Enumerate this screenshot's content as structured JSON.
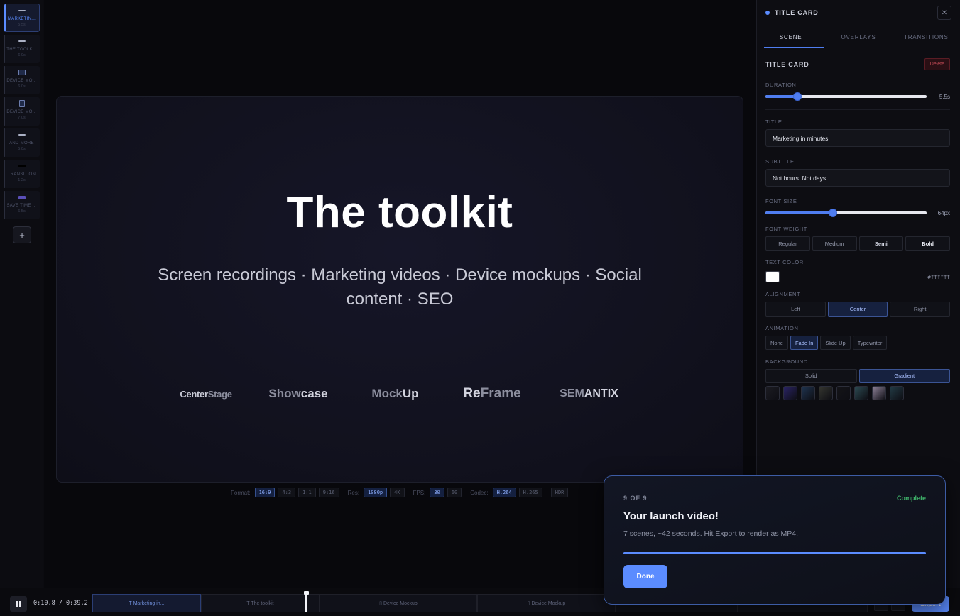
{
  "scenes": [
    {
      "name": "MARKETIN...",
      "duration": "5.5s",
      "glyph": "bar",
      "active": true
    },
    {
      "name": "THE TOOLK...",
      "duration": "6.0s",
      "glyph": "bar",
      "active": false
    },
    {
      "name": "DEVICE MO...",
      "duration": "6.0s",
      "glyph": "box",
      "active": false
    },
    {
      "name": "DEVICE MO...",
      "duration": "7.0s",
      "glyph": "phone",
      "active": false
    },
    {
      "name": "AND MORE",
      "duration": "5.0s",
      "glyph": "bar",
      "active": false
    },
    {
      "name": "TRANSITION",
      "duration": "1.2s",
      "glyph": "black",
      "active": false
    },
    {
      "name": "SAVE TIME ...",
      "duration": "6.5s",
      "glyph": "purple",
      "active": false
    }
  ],
  "add_scene_label": "+",
  "preview": {
    "title": "The toolkit",
    "subtitle": "Screen recordings · Marketing videos · Device mockups · Social content · SEO",
    "logos": {
      "centerstage": {
        "part1": "Center",
        "part2": "Stage"
      },
      "showcase": {
        "part1": "Show",
        "part2": "case"
      },
      "mockup": {
        "part1": "Mock",
        "part2": "Up"
      },
      "reframe": {
        "part1": "Re",
        "part2": "Frame"
      },
      "semantix": {
        "part1": "SEM",
        "part2": "ANTIX"
      }
    }
  },
  "format_bar": {
    "format_label": "Format:",
    "formats": [
      {
        "label": "16:9",
        "on": true
      },
      {
        "label": "4:3",
        "on": false
      },
      {
        "label": "1:1",
        "on": false
      },
      {
        "label": "9:16",
        "on": false
      }
    ],
    "res_label": "Res:",
    "resolutions": [
      {
        "label": "1080p",
        "on": true
      },
      {
        "label": "4K",
        "on": false
      }
    ],
    "fps_label": "FPS:",
    "fps": [
      {
        "label": "30",
        "on": true
      },
      {
        "label": "60",
        "on": false
      }
    ],
    "codec_label": "Codec:",
    "codecs": [
      {
        "label": "H.264",
        "on": true
      },
      {
        "label": "H.265",
        "on": false
      }
    ],
    "hdr_label": "HDR"
  },
  "panel": {
    "header_title": "TITLE CARD",
    "close_glyph": "✕",
    "tabs": [
      "SCENE",
      "OVERLAYS",
      "TRANSITIONS"
    ],
    "section_title": "TITLE CARD",
    "delete_label": "Delete",
    "duration": {
      "label": "DURATION",
      "value_text": "5.5s",
      "fraction": 0.2
    },
    "title_field": {
      "label": "TITLE",
      "value": "Marketing in minutes"
    },
    "subtitle_field": {
      "label": "SUBTITLE",
      "value": "Not hours. Not days."
    },
    "font_size": {
      "label": "FONT SIZE",
      "value_text": "64px",
      "fraction": 0.42
    },
    "font_weight": {
      "label": "FONT WEIGHT",
      "options": [
        "Regular",
        "Medium",
        "Semi",
        "Bold"
      ]
    },
    "text_color": {
      "label": "TEXT COLOR",
      "hex": "#ffffff"
    },
    "alignment": {
      "label": "ALIGNMENT",
      "options": [
        "Left",
        "Center",
        "Right"
      ],
      "selected": "Center"
    },
    "animation": {
      "label": "ANIMATION",
      "options": [
        "None",
        "Fade In",
        "Slide Up",
        "Typewriter"
      ],
      "selected": "Fade In"
    },
    "background": {
      "label": "BACKGROUND",
      "options": [
        "Solid",
        "Gradient"
      ],
      "selected": "Gradient",
      "swatches": [
        "#1c1c22",
        "#2a2466",
        "#1f3450",
        "#34352f",
        "#141418",
        "#2c4a52",
        "#8c8096",
        "#223a44"
      ]
    }
  },
  "timeline": {
    "time": "0:10.8 / 0:39.2",
    "progress_fraction": 0.275,
    "clips": [
      {
        "label": "T Marketing in...",
        "active": true
      },
      {
        "label": "T The toolkit",
        "active": false
      },
      {
        "label": "▯ Device Mockup",
        "active": false
      },
      {
        "label": "▯ Device Mockup",
        "active": false
      },
      {
        "label": "",
        "active": false
      },
      {
        "label": "",
        "active": false
      }
    ],
    "export_label": "Export"
  },
  "done_card": {
    "step": "9 OF 9",
    "status": "Complete",
    "title": "Your launch video!",
    "description": "7 scenes, ~42 seconds. Hit Export to render as MP4.",
    "progress_fraction": 1.0,
    "done_label": "Done"
  },
  "colors": {
    "accent": "#5b8cff",
    "complete": "#3fb36a",
    "danger": "#c24a56"
  }
}
